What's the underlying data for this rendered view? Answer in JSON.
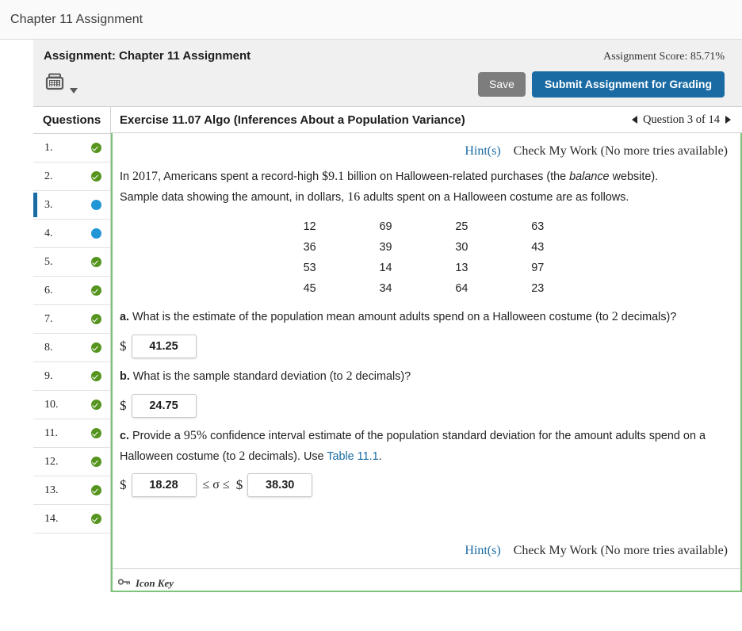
{
  "window": {
    "title": "Chapter 11 Assignment"
  },
  "header": {
    "assignment_title": "Assignment: Chapter 11 Assignment",
    "score_label": "Assignment Score: 85.71%",
    "calculator_icon": "calculator-icon",
    "save_label": "Save",
    "submit_label": "Submit Assignment for Grading",
    "colors": {
      "save_bg": "#7d7d7d",
      "submit_bg": "#1a6ba4",
      "header_bg": "#f0f0f0"
    }
  },
  "sidebar": {
    "heading": "Questions",
    "items": [
      {
        "label": "1.",
        "status": "correct",
        "active": false
      },
      {
        "label": "2.",
        "status": "correct",
        "active": false
      },
      {
        "label": "3.",
        "status": "current",
        "active": true
      },
      {
        "label": "4.",
        "status": "current",
        "active": false
      },
      {
        "label": "5.",
        "status": "correct",
        "active": false
      },
      {
        "label": "6.",
        "status": "correct",
        "active": false
      },
      {
        "label": "7.",
        "status": "correct",
        "active": false
      },
      {
        "label": "8.",
        "status": "correct",
        "active": false
      },
      {
        "label": "9.",
        "status": "correct",
        "active": false
      },
      {
        "label": "10.",
        "status": "correct",
        "active": false
      },
      {
        "label": "11.",
        "status": "correct",
        "active": false
      },
      {
        "label": "12.",
        "status": "correct",
        "active": false
      },
      {
        "label": "13.",
        "status": "correct",
        "active": false
      },
      {
        "label": "14.",
        "status": "correct",
        "active": false
      }
    ]
  },
  "exercise": {
    "title": "Exercise 11.07 Algo (Inferences About a Population Variance)",
    "nav_label": "Question 3 of 14",
    "prev_icon": "left-arrow-icon",
    "next_icon": "right-arrow-icon",
    "hint_label": "Hint(s)",
    "check_my_work_label": "Check My Work (No more tries available)",
    "statement": {
      "line1_a": "In ",
      "line1_year": "2017",
      "line1_b": ", Americans spent a record-high ",
      "line1_amount": "$9.1",
      "line1_c": " billion on Halloween-related purchases (the ",
      "line1_italic": "balance",
      "line1_d": " website).",
      "line2_a": "Sample data showing the amount, in dollars, ",
      "line2_n": "16",
      "line2_b": " adults spent on a Halloween costume are as follows."
    },
    "data_rows": [
      [
        "12",
        "69",
        "25",
        "63"
      ],
      [
        "36",
        "39",
        "30",
        "43"
      ],
      [
        "53",
        "14",
        "13",
        "97"
      ],
      [
        "45",
        "34",
        "64",
        "23"
      ]
    ],
    "parts": [
      {
        "letter": "a.",
        "text_a": " What is the estimate of the population mean amount adults spend on a Halloween costume (to ",
        "num": "2",
        "text_b": " decimals)?",
        "currency": "$",
        "value": "41.25"
      },
      {
        "letter": "b.",
        "text_a": " What is the sample standard deviation (to ",
        "num": "2",
        "text_b": " decimals)?",
        "currency": "$",
        "value": "24.75"
      },
      {
        "letter": "c.",
        "text_a": " Provide a ",
        "num": "95%",
        "text_b": " confidence interval estimate of the population standard deviation for the amount adults spend on a Halloween costume (to ",
        "num2": "2",
        "text_c": " decimals). Use ",
        "link": "Table 11.1",
        "text_d": ".",
        "currency": "$",
        "lower_value": "18.28",
        "middle": "≤ σ ≤",
        "currency2": "$",
        "upper_value": "38.30"
      }
    ],
    "icon_key_label": "Icon Key",
    "key_icon": "key-icon"
  }
}
